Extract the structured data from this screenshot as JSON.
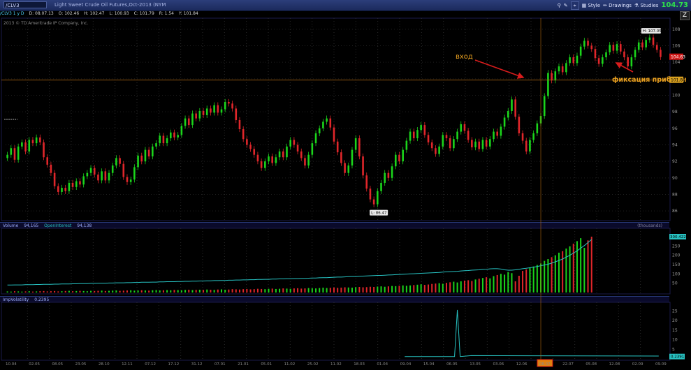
{
  "toolbar": {
    "symbol": "/CLV3",
    "description": "Light Sweet Crude Oil Futures,Oct-2013 (NYM",
    "style_label": "Style",
    "drawings_label": "Drawings",
    "studies_label": "Studies",
    "last_price": "104.73",
    "z_label": "Z"
  },
  "info": {
    "symbol_period": "/CLV3 1 y D",
    "date": "D: 08.07.13",
    "open": "O: 102.46",
    "high": "H: 102.47",
    "low": "L: 100.93",
    "close": "C: 101.79",
    "range": "R: 1.54",
    "y": "Y: 101.84",
    "copyright": "2013 © TD Ameritrade IP Company, Inc."
  },
  "annotations": {
    "entry": "вход",
    "take_profit": "фиксация прибыли",
    "high_label": "H: 107.05",
    "low_label": "L: 86.47"
  },
  "price_axis": {
    "ticks": [
      "108",
      "106",
      "104",
      "102",
      "100",
      "98",
      "96",
      "94",
      "92",
      "90",
      "88",
      "86"
    ],
    "current_label": "104.63",
    "line_label": "101.84"
  },
  "volume_panel": {
    "labels": [
      "Volume",
      "94,165",
      "OpenInterest",
      "94,138"
    ],
    "units": "(thousands)",
    "ticks": [
      "300",
      "250",
      "200",
      "150",
      "100",
      "50"
    ],
    "current_label": "300.422"
  },
  "iv_panel": {
    "labels": [
      "ImpVolatility",
      "0.2395"
    ],
    "ticks": [
      "25",
      "20",
      "15",
      "10",
      "5"
    ],
    "current_label": "0.2391"
  },
  "time_axis": {
    "ticks": [
      "10.04",
      "02.05",
      "08.05",
      "23.05",
      "28.10",
      "12.11",
      "07.12",
      "17.12",
      "31.12",
      "07.01",
      "21.01",
      "05.01",
      "11.02",
      "25.02",
      "11.02",
      "18.03",
      "01.04",
      "09.04",
      "15.04",
      "06.05",
      "13.05",
      "03.06",
      "12.06",
      "08.07",
      "22.07",
      "05.08",
      "12.08",
      "02.09",
      "09.09"
    ],
    "highlight": "08.07"
  },
  "colors": {
    "up": "#1bd41b",
    "down": "#e0262a",
    "volume_line": "#27c2c2",
    "guide": "#b36a10",
    "arrow": "#d81c1c",
    "annotation_text": "#e8a020"
  },
  "chart_data": {
    "type": "candlestick",
    "title": "Light Sweet Crude Oil Futures,Oct-2013 (NYM",
    "ylim": [
      85,
      109
    ],
    "close": [
      92.8,
      93.6,
      92.2,
      93.8,
      94.3,
      93.2,
      94.6,
      94.2,
      94.9,
      94.3,
      92.5,
      91.6,
      90.6,
      89.0,
      88.3,
      88.8,
      88.4,
      89.4,
      88.9,
      89.6,
      89.2,
      90.2,
      90.6,
      91.2,
      90.4,
      89.7,
      90.8,
      89.7,
      90.6,
      91.5,
      92.4,
      91.7,
      90.1,
      89.5,
      89.8,
      91.3,
      92.7,
      92.0,
      93.4,
      92.6,
      93.8,
      94.2,
      95.1,
      94.2,
      94.8,
      95.5,
      94.9,
      95.2,
      96.3,
      97.2,
      96.4,
      97.8,
      97.2,
      98.1,
      97.6,
      98.4,
      97.9,
      98.8,
      97.9,
      98.3,
      99.2,
      99.0,
      98.4,
      97.0,
      95.9,
      94.7,
      94.0,
      93.5,
      92.8,
      92.0,
      91.2,
      92.0,
      92.6,
      91.8,
      92.5,
      93.2,
      92.5,
      93.8,
      94.6,
      94.0,
      93.2,
      92.4,
      91.5,
      92.8,
      94.2,
      95.4,
      96.0,
      96.8,
      97.2,
      96.1,
      94.4,
      93.1,
      91.8,
      90.6,
      91.5,
      93.4,
      94.8,
      92.6,
      90.3,
      88.7,
      87.4,
      86.8,
      88.4,
      89.4,
      90.6,
      90.0,
      91.4,
      92.8,
      92.0,
      93.4,
      94.5,
      95.6,
      94.8,
      95.8,
      96.4,
      95.2,
      94.3,
      93.6,
      92.9,
      93.8,
      95.2,
      94.8,
      93.6,
      94.7,
      95.6,
      96.5,
      95.7,
      94.6,
      93.7,
      94.4,
      93.5,
      94.6,
      93.8,
      94.7,
      95.6,
      95.1,
      96.2,
      97.3,
      98.1,
      99.5,
      97.4,
      95.4,
      94.5,
      93.2,
      94.6,
      95.4,
      96.6,
      97.5,
      99.9,
      102.7,
      101.8,
      102.9,
      103.5,
      102.8,
      103.9,
      104.6,
      103.9,
      104.8,
      105.9,
      106.6,
      106.0,
      105.6,
      104.5,
      103.8,
      104.6,
      105.2,
      106.1,
      105.4,
      106.2,
      105.3,
      104.6,
      103.5,
      104.6,
      105.5,
      106.4,
      105.8,
      106.7,
      107.0,
      106.1,
      105.5,
      104.63
    ],
    "volume_thousands": [
      6,
      5,
      7,
      6,
      5,
      6,
      7,
      5,
      6,
      7,
      8,
      6,
      7,
      8,
      6,
      7,
      8,
      9,
      7,
      8,
      9,
      8,
      7,
      9,
      8,
      9,
      10,
      8,
      9,
      10,
      11,
      9,
      10,
      11,
      12,
      10,
      11,
      12,
      11,
      10,
      12,
      13,
      11,
      12,
      13,
      12,
      14,
      13,
      12,
      14,
      15,
      13,
      14,
      15,
      14,
      16,
      15,
      14,
      16,
      17,
      15,
      16,
      18,
      17,
      16,
      18,
      19,
      17,
      18,
      20,
      19,
      18,
      20,
      21,
      19,
      20,
      22,
      21,
      20,
      22,
      23,
      21,
      22,
      24,
      23,
      22,
      24,
      26,
      24,
      25,
      27,
      25,
      26,
      28,
      27,
      26,
      29,
      30,
      28,
      29,
      31,
      30,
      32,
      33,
      31,
      33,
      35,
      34,
      36,
      38,
      36,
      38,
      40,
      42,
      44,
      41,
      43,
      46,
      48,
      50,
      47,
      52,
      55,
      58,
      54,
      60,
      64,
      66,
      62,
      70,
      74,
      78,
      82,
      76,
      88,
      94,
      100,
      96,
      110,
      104,
      60,
      90,
      116,
      124,
      132,
      140,
      148,
      156,
      170,
      180,
      190,
      200,
      214,
      222,
      236,
      248,
      262,
      276,
      292,
      240,
      280,
      300
    ],
    "open_interest_thousands": [
      40,
      40,
      41,
      41,
      41,
      42,
      42,
      42,
      43,
      43,
      44,
      44,
      44,
      45,
      45,
      46,
      46,
      46,
      47,
      47,
      48,
      48,
      48,
      49,
      49,
      50,
      50,
      50,
      51,
      51,
      52,
      52,
      52,
      53,
      53,
      54,
      54,
      55,
      55,
      55,
      56,
      56,
      57,
      57,
      58,
      58,
      58,
      59,
      59,
      60,
      60,
      61,
      61,
      62,
      62,
      63,
      63,
      64,
      64,
      65,
      65,
      66,
      66,
      67,
      67,
      68,
      68,
      69,
      69,
      70,
      70,
      71,
      71,
      72,
      72,
      73,
      73,
      74,
      74,
      75,
      75,
      76,
      76,
      77,
      78,
      78,
      79,
      80,
      80,
      81,
      82,
      83,
      83,
      84,
      85,
      86,
      86,
      87,
      88,
      89,
      90,
      91,
      92,
      92,
      93,
      94,
      95,
      96,
      97,
      98,
      99,
      100,
      101,
      102,
      103,
      104,
      105,
      106,
      107,
      108,
      110,
      111,
      112,
      113,
      114,
      116,
      117,
      118,
      120,
      121,
      122,
      124,
      125,
      127,
      128,
      128,
      126,
      122,
      120,
      120,
      122,
      125,
      128,
      130,
      133,
      136,
      140,
      144,
      148,
      152,
      158,
      165,
      172,
      180,
      190,
      200,
      212,
      224,
      238,
      252,
      268,
      285
    ],
    "imp_volatility": {
      "spike_value": 25.5,
      "baseline": 1.2
    }
  }
}
